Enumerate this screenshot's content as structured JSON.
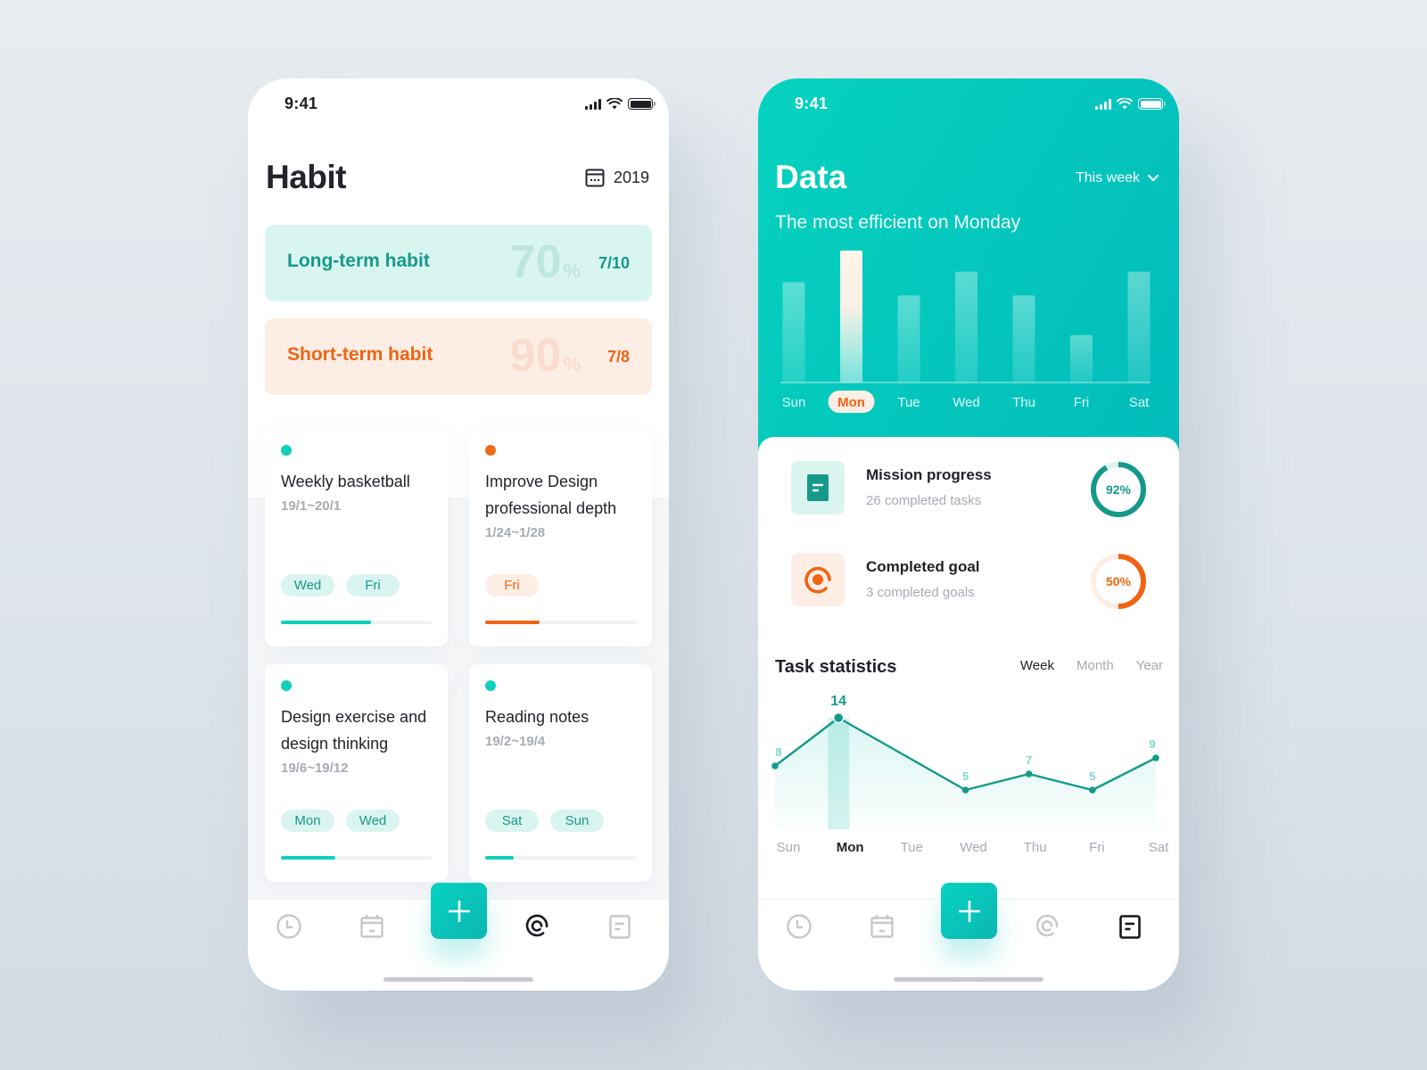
{
  "status_bar": {
    "time": "9:41"
  },
  "habit_screen": {
    "title": "Habit",
    "year": "2019",
    "summary": [
      {
        "label": "Long-term habit",
        "percent": "70",
        "percent_sign": "%",
        "fraction": "7/10",
        "color": "#16998a"
      },
      {
        "label": "Short-term habit",
        "percent": "90",
        "percent_sign": "%",
        "fraction": "7/8",
        "color": "#ef6414"
      }
    ],
    "habits": [
      {
        "name": "Weekly basketball",
        "range": "19/1~20/1",
        "days": [
          "Wed",
          "Fri"
        ],
        "accent": "teal",
        "color": "#0fd0bd",
        "progress": 0.6
      },
      {
        "name": "Improve Design professional depth",
        "range": "1/24~1/28",
        "days": [
          "Fri"
        ],
        "accent": "orange",
        "color": "#f06a18",
        "progress": 0.36
      },
      {
        "name": "Design exercise and design thinking",
        "range": "19/6~19/12",
        "days": [
          "Mon",
          "Wed"
        ],
        "accent": "teal",
        "color": "#0fd0bd",
        "progress": 0.36
      },
      {
        "name": "Reading notes",
        "range": "19/2~19/4",
        "days": [
          "Sat",
          "Sun"
        ],
        "accent": "teal",
        "color": "#0fd0bd",
        "progress": 0.19
      }
    ],
    "nav": {
      "active": "goals"
    }
  },
  "data_screen": {
    "title": "Data",
    "period": "This week",
    "subtitle": "The most efficient on Monday",
    "metrics": [
      {
        "title": "Mission progress",
        "subtitle": "26 completed tasks",
        "percent_label": "92%",
        "value": 0.92,
        "color": "#16998a",
        "track": "#daf5f0",
        "bg": "#daf5f0"
      },
      {
        "title": "Completed goal",
        "subtitle": "3 completed goals",
        "percent_label": "50%",
        "value": 0.5,
        "color": "#ef6414",
        "track": "#fdeee5",
        "bg": "#fdeee5"
      }
    ],
    "task_statistics": {
      "title": "Task statistics",
      "tabs": [
        "Week",
        "Month",
        "Year"
      ],
      "active_tab": "Week"
    },
    "nav": {
      "active": "stats"
    }
  },
  "chart_data": [
    {
      "type": "bar",
      "title": "The most efficient on Monday",
      "categories": [
        "Sun",
        "Mon",
        "Tue",
        "Wed",
        "Thu",
        "Fri",
        "Sat"
      ],
      "values": [
        7.6,
        10,
        6.6,
        8.4,
        6.6,
        3.6,
        8.4
      ],
      "highlight": "Mon",
      "ylim": [
        0,
        10
      ]
    },
    {
      "type": "line",
      "title": "Task statistics",
      "categories": [
        "Sun",
        "Mon",
        "Tue",
        "Wed",
        "Thu",
        "Fri",
        "Sat"
      ],
      "values": [
        8,
        14,
        null,
        5,
        7,
        5,
        9
      ],
      "data_labels": [
        "8",
        "14",
        "",
        "5",
        "7",
        "5",
        "9"
      ],
      "highlight": "Mon",
      "ylim": [
        0,
        16
      ]
    }
  ]
}
